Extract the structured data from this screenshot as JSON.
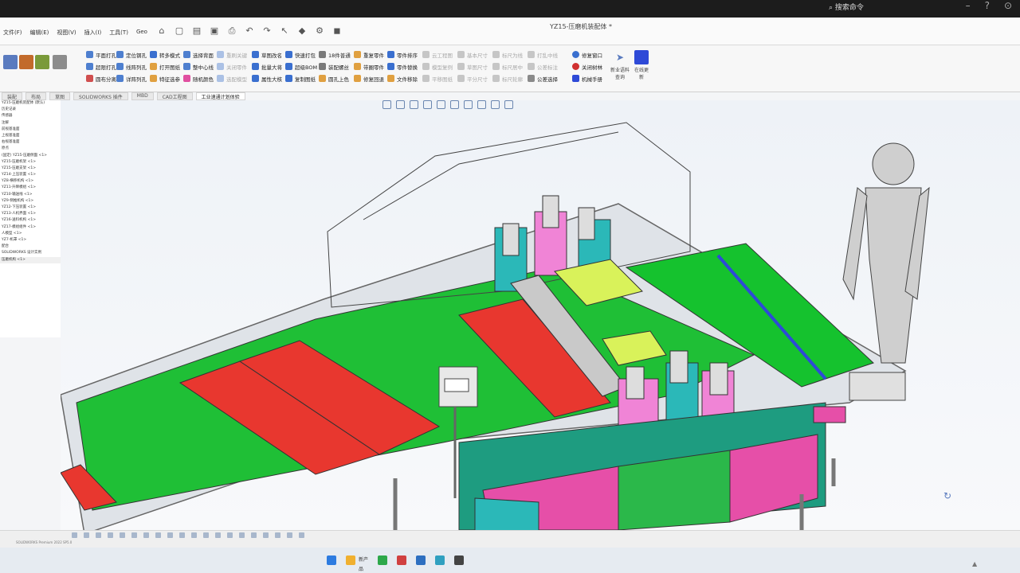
{
  "window": {
    "title": "YZ15-压磨机装配体 *",
    "search_label": "搜索命令",
    "min_icon": "minimize-icon",
    "help_icon": "help-icon"
  },
  "menu": [
    "文件(F)",
    "编辑(E)",
    "视图(V)",
    "插入(I)",
    "工具(T)",
    "Geo"
  ],
  "ribbon": {
    "col1": [
      "平面打孔",
      "超限打孔",
      "圆布分离"
    ],
    "col2": [
      "定位钢孔",
      "线阵列孔",
      "详阵列孔"
    ],
    "col3": [
      "转多模式",
      "打开图纸",
      "特征选参"
    ],
    "col4": [
      "选择背面",
      "整中心线",
      "随机颜色"
    ],
    "col5_disabled": [
      "重刷关键",
      "关闭零件",
      "选配模型"
    ],
    "col6": [
      "草图改名",
      "批量大将",
      "属性大核"
    ],
    "col7": [
      "快速打包",
      "超级BOM",
      "复制图纸"
    ],
    "col8": [
      "18件普通",
      "装配螺丝",
      "圆孔上色"
    ],
    "col9": [
      "重复零件",
      "带圈零件",
      "修复回退"
    ],
    "col10": [
      "零件排序",
      "零件替换",
      "文件移除"
    ],
    "col11_disabled": [
      "云工程图",
      "模型复例",
      "平移图纸"
    ],
    "col12_disabled": [
      "基本尺寸",
      "草图尺寸",
      "平分尺寸"
    ],
    "col13_disabled": [
      "标尺为线",
      "标尺居中",
      "标尺轮廓"
    ],
    "col14_disabled": [
      "打乱中线",
      "公差标注",
      "公差选择"
    ],
    "col15": [
      "修复窗口",
      "关闭树林",
      "机械手册"
    ],
    "big_btn1": "新业语料查询",
    "big_btn2": "在线更新"
  },
  "tabs": [
    "装配",
    "布局",
    "草图",
    "SOLIDWORKS 插件",
    "MBD",
    "CAD工程图",
    "工业速通计划体验"
  ],
  "tree": {
    "items": [
      "YZ15-压磨机装配体 (默认)",
      "历史记录",
      "传感器",
      "注解",
      "前视基准面",
      "上视基准面",
      "右视基准面",
      "原点",
      "(固定) YZ15-压磨侧面 <1>",
      "YZ15-压磨机架 <1>",
      "YZ15-压磨支架 <1>",
      "YZ14-上压装置 <1>",
      "YZ8-横移机构 <1>",
      "YZ11-升降模组 <1>",
      "YZ10-输送线 <1>",
      "YZ9-侧推机构 <1>",
      "YZ12-下压装置 <1>",
      "YZ13-人机界面 <1>",
      "YZ16-送料机构 <1>",
      "YZ17-模组组件 <1>",
      "人模型 <1>",
      "YZ7-机罩 <1>",
      "配合",
      "SOLIDWORKS 设计实例",
      "压磨机构 <1>"
    ]
  },
  "status": {
    "text": "SOLIDWORKS Premium 2022 SP5.0"
  },
  "taskbar": {
    "folder_label": "新产品"
  },
  "colors": {
    "green": "#12c032",
    "red": "#ea3935",
    "magenta": "#e44fc6",
    "teal": "#2bb8b8",
    "purple": "#8a3aa2",
    "blue": "#2e4ad7"
  }
}
